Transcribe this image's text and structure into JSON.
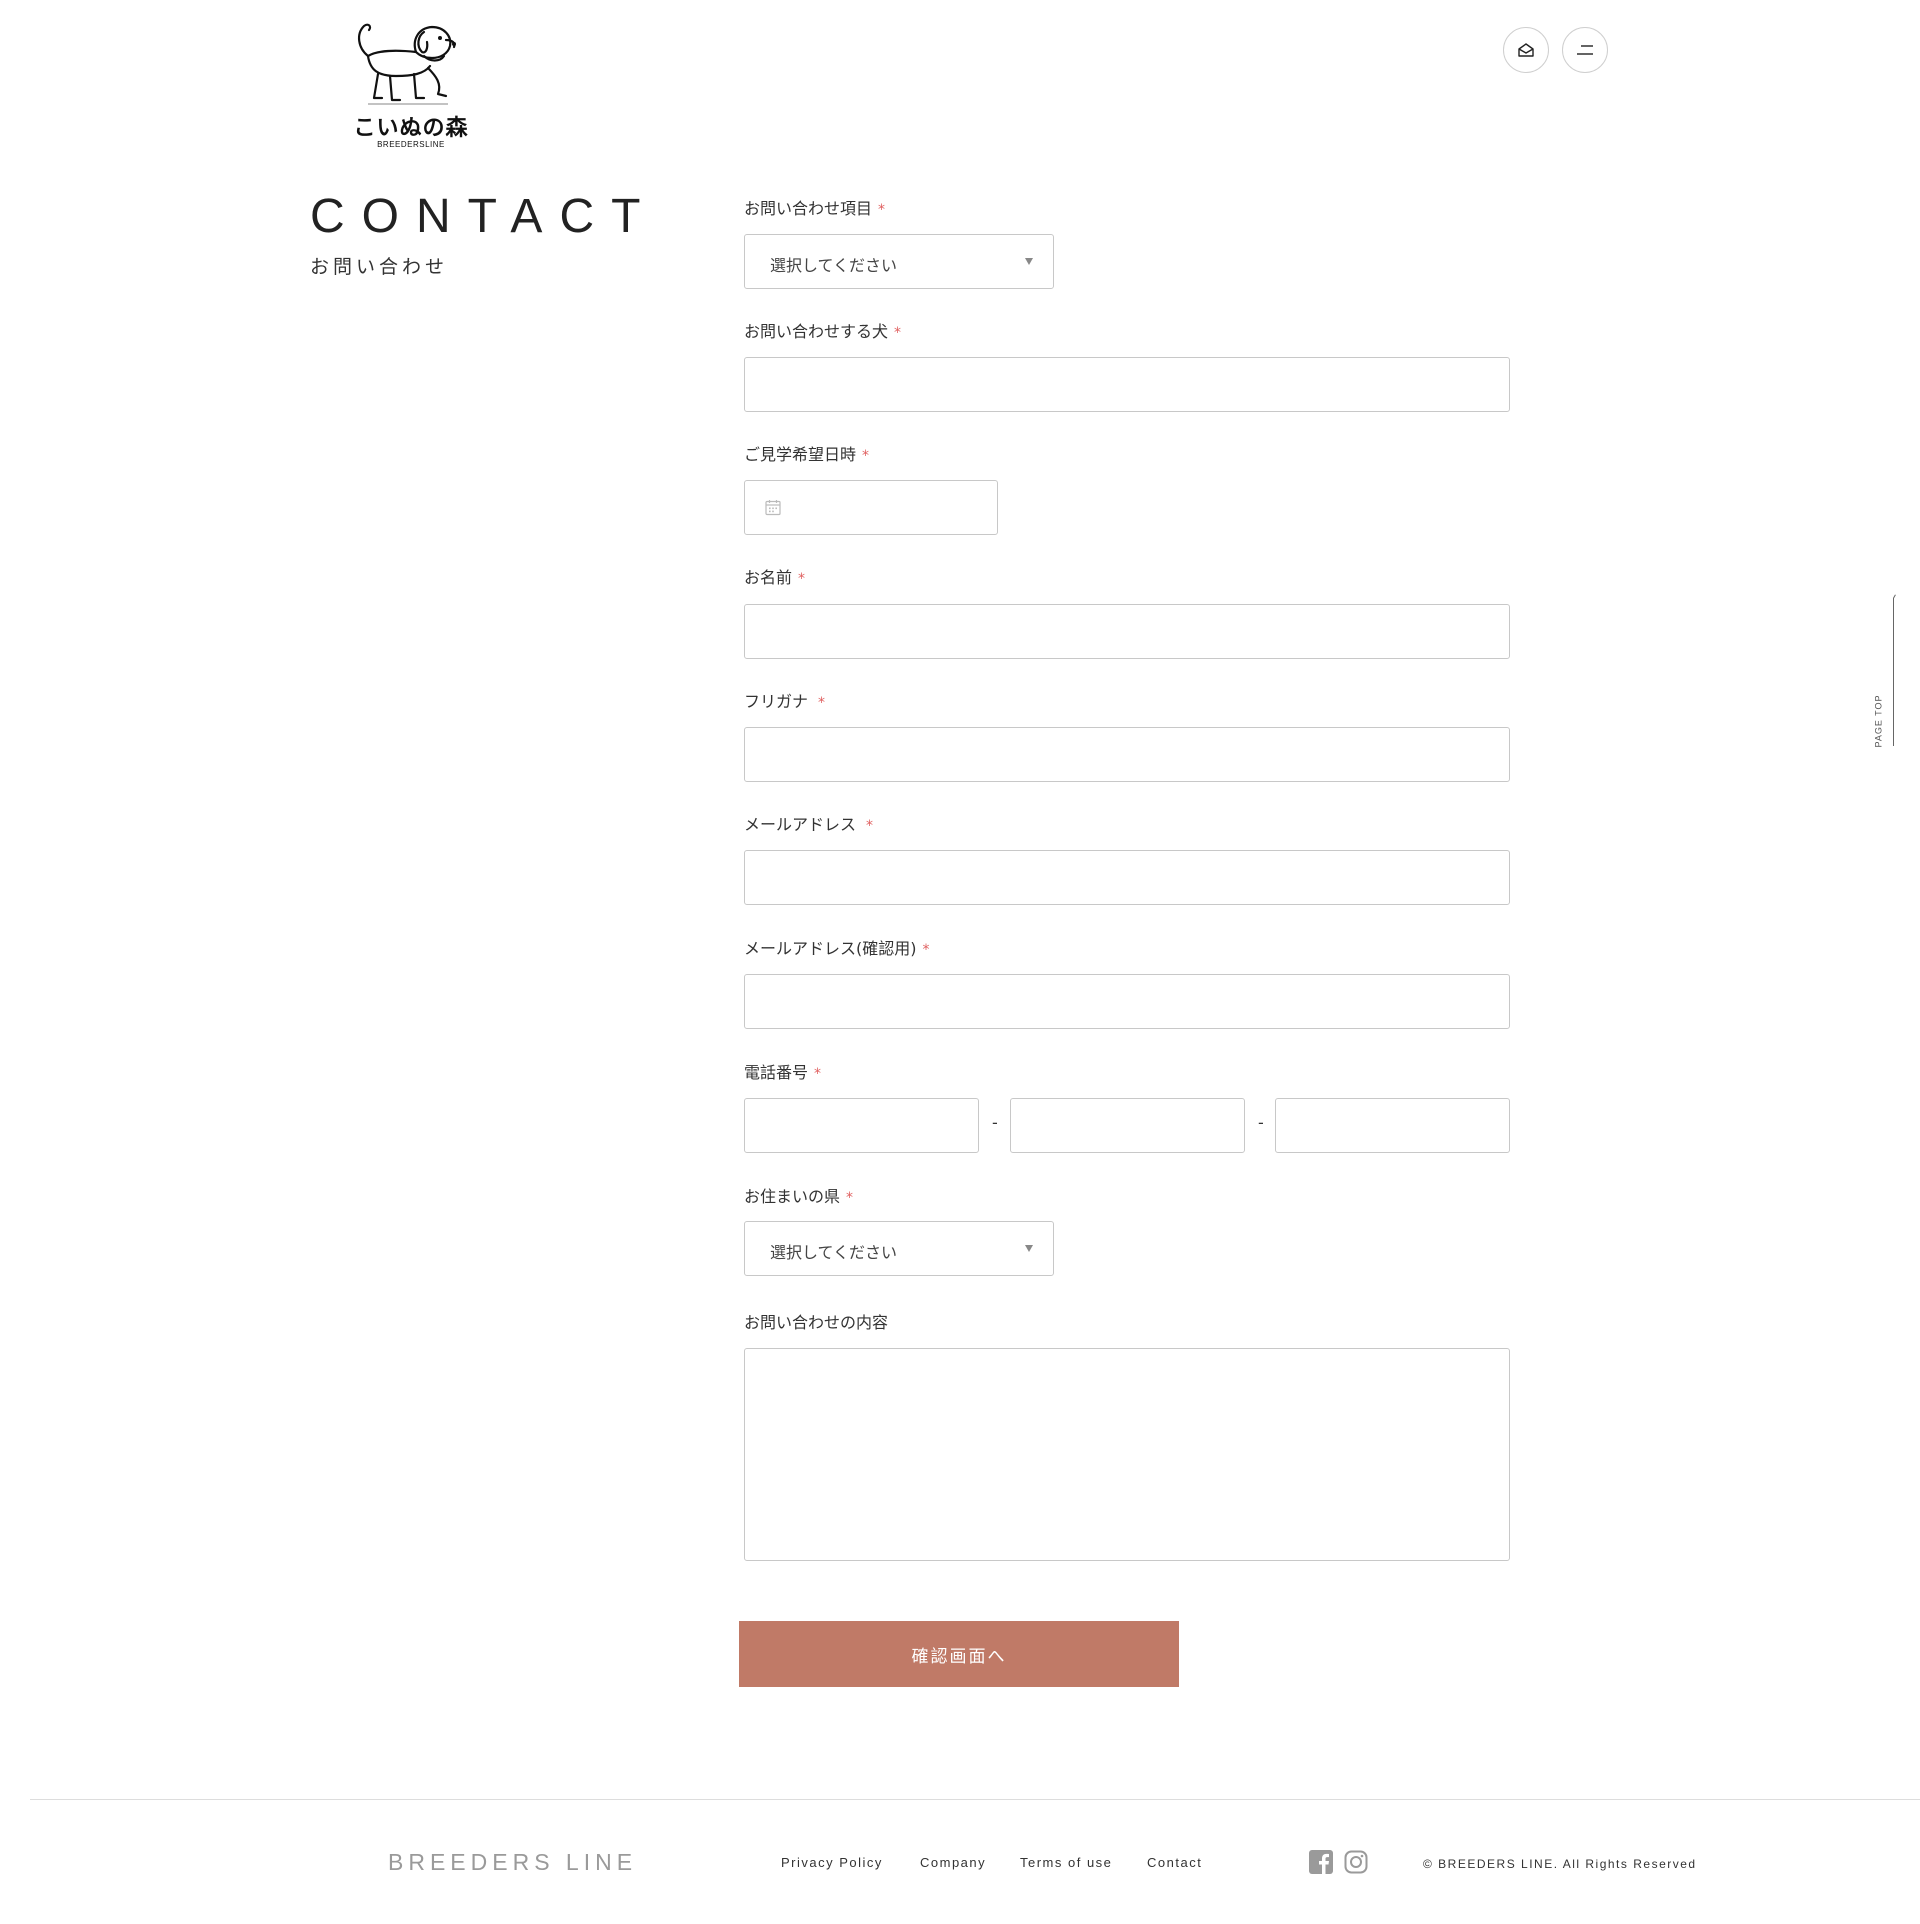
{
  "header": {
    "logo_text": "こいぬの森",
    "logo_sub": "BREEDERSLINE",
    "mail_icon": "mail-open-icon",
    "menu_icon": "menu-icon"
  },
  "page": {
    "title": "CONTACT",
    "subtitle": "お問い合わせ"
  },
  "form": {
    "required_mark": "*",
    "inquiry_type": {
      "label": "お問い合わせ項目",
      "selected": "選択してください"
    },
    "dog": {
      "label": "お問い合わせする犬",
      "value": ""
    },
    "visit_date": {
      "label": "ご見学希望日時",
      "icon": "calendar-icon"
    },
    "name": {
      "label": "お名前",
      "value": ""
    },
    "furigana": {
      "label": "フリガナ",
      "value": ""
    },
    "email": {
      "label": "メールアドレス",
      "value": ""
    },
    "email_confirm": {
      "label": "メールアドレス(確認用)",
      "value": ""
    },
    "phone": {
      "label": "電話番号",
      "separator": "-"
    },
    "prefecture": {
      "label": "お住まいの県",
      "selected": "選択してください"
    },
    "message": {
      "label": "お問い合わせの内容",
      "value": ""
    },
    "submit_label": "確認画面へ"
  },
  "page_top": {
    "label": "PAGE TOP"
  },
  "footer": {
    "brand": "BREEDERS LINE",
    "nav": [
      "Privacy Policy",
      "Company",
      "Terms of use",
      "Contact"
    ],
    "social_icons": [
      "facebook-icon",
      "instagram-icon"
    ],
    "copyright": "© BREEDERS LINE. All Rights Reserved"
  },
  "colors": {
    "accent": "#c07a67",
    "required": "#e06060",
    "border": "#c8c8c8",
    "brand_gray": "#9a9a9a"
  }
}
